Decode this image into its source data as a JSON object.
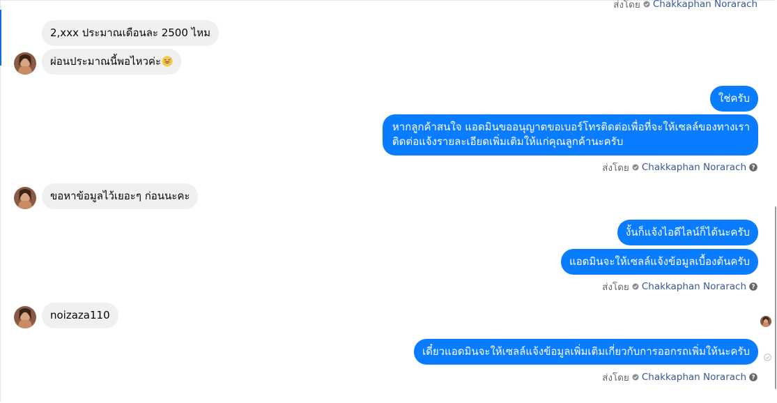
{
  "sent_by": {
    "prefix": "ส่งโดย",
    "name": "Chakkaphan Norarach"
  },
  "messages": {
    "in1": "2,xxx ประมาณเดือนละ 2500 ไหม",
    "in2": "ผ่อนประมาณนี้พอไหวค่ะ",
    "out1": "ใช่ครับ",
    "out2_line1": "หากลูกค้าสนใจ แอดมินขออนุญาตขอเบอร์โทรติดต่อเพื่อที่จะให้เซลล์ของทางเรา",
    "out2_line2": "ติดต่อแจ้งรายละเอียดเพิ่มเติมให้แก่คุณลูกค้านะครับ",
    "in3": "ขอหาข้อมูลไว้เยอะๆ ก่อนนะคะ",
    "out3": "งั้นก็แจ้งไอดีไลน์ก็ได้นะครับ",
    "out4": "แอดมินจะให้เซลล์แจ้งข้อมูลเบื้องต้นครับ",
    "in4": "noizaza110",
    "out5": "เดี๋ยวแอดมินจะให้เซลล์แจ้งข้อมูลเพิ่มเติมเกี่ยวกับการออกรถเพิ่มให้นะครับ"
  },
  "icons": {
    "emoji": "grinning-sweat-emoji",
    "verified": "check-circle-icon",
    "help": "question-icon"
  },
  "colors": {
    "outgoing": "#0a7cff",
    "incoming": "#f0f0f0",
    "link": "#385898",
    "meta": "#65676b"
  }
}
